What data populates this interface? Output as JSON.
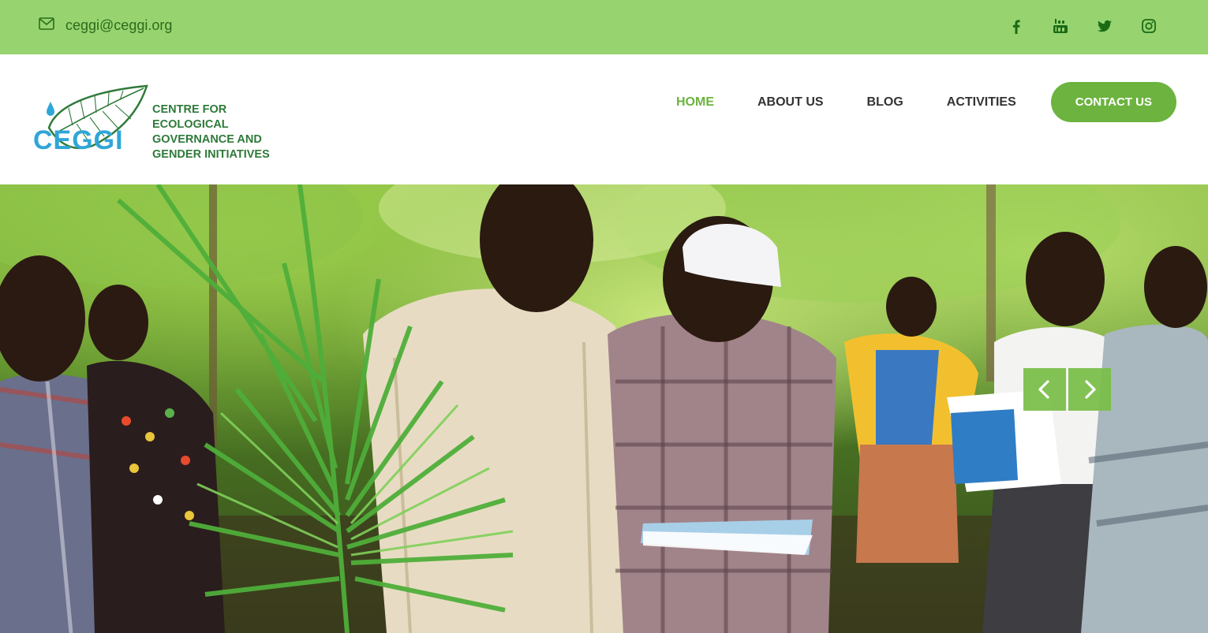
{
  "topbar": {
    "email": "ceggi@ceggi.org",
    "social": [
      "facebook-icon",
      "youtube-icon",
      "twitter-icon",
      "instagram-icon"
    ]
  },
  "logo": {
    "mark": "CEGGI",
    "line1": "CENTRE FOR ECOLOGICAL",
    "line2": "GOVERNANCE AND",
    "line3": "GENDER INITIATIVES"
  },
  "nav": {
    "home": "HOME",
    "about": "ABOUT US",
    "blog": "BLOG",
    "activities": "ACTIVITIES",
    "contact": "CONTACT US"
  },
  "colors": {
    "topbar": "#97d470",
    "accent": "#6cb33f",
    "text_dark": "#333333"
  }
}
